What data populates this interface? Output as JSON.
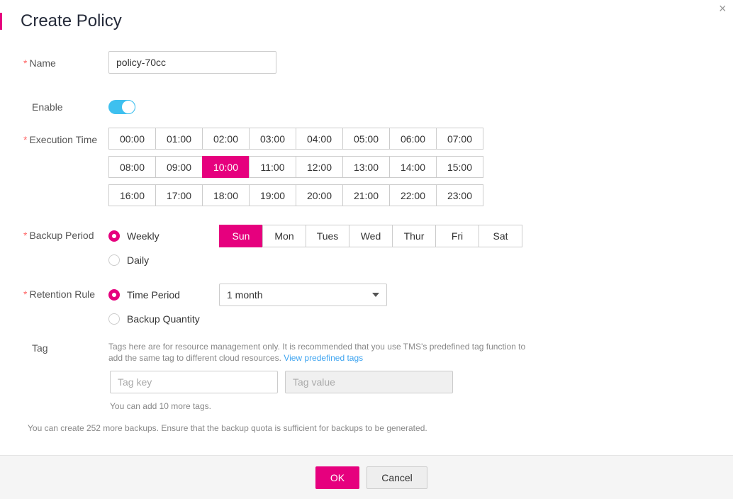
{
  "dialog": {
    "title": "Create Policy",
    "close_icon": "close-icon"
  },
  "name": {
    "label": "Name",
    "value": "policy-70cc"
  },
  "enable": {
    "label": "Enable",
    "on": true
  },
  "execution_time": {
    "label": "Execution Time",
    "options": [
      "00:00",
      "01:00",
      "02:00",
      "03:00",
      "04:00",
      "05:00",
      "06:00",
      "07:00",
      "08:00",
      "09:00",
      "10:00",
      "11:00",
      "12:00",
      "13:00",
      "14:00",
      "15:00",
      "16:00",
      "17:00",
      "18:00",
      "19:00",
      "20:00",
      "21:00",
      "22:00",
      "23:00"
    ],
    "selected": "10:00"
  },
  "backup_period": {
    "label": "Backup Period",
    "weekly": "Weekly",
    "daily": "Daily",
    "selected": "Weekly",
    "days": [
      "Sun",
      "Mon",
      "Tues",
      "Wed",
      "Thur",
      "Fri",
      "Sat"
    ],
    "selected_day": "Sun"
  },
  "retention": {
    "label": "Retention Rule",
    "time_period": "Time Period",
    "backup_quantity": "Backup Quantity",
    "selected": "Time Period",
    "select_value": "1 month"
  },
  "tag": {
    "label": "Tag",
    "help": "Tags here are for resource management only. It is recommended that you use TMS's predefined tag function to add the same tag to different cloud resources.",
    "link": "View predefined tags",
    "key_placeholder": "Tag key",
    "value_placeholder": "Tag value",
    "remaining": "You can add 10 more tags."
  },
  "quota_note": "You can create 252 more backups. Ensure that the backup quota is sufficient for backups to be generated.",
  "footer": {
    "ok": "OK",
    "cancel": "Cancel"
  },
  "colors": {
    "accent": "#e6007e",
    "toggle": "#3ec0ef",
    "link": "#3ea4f0"
  }
}
